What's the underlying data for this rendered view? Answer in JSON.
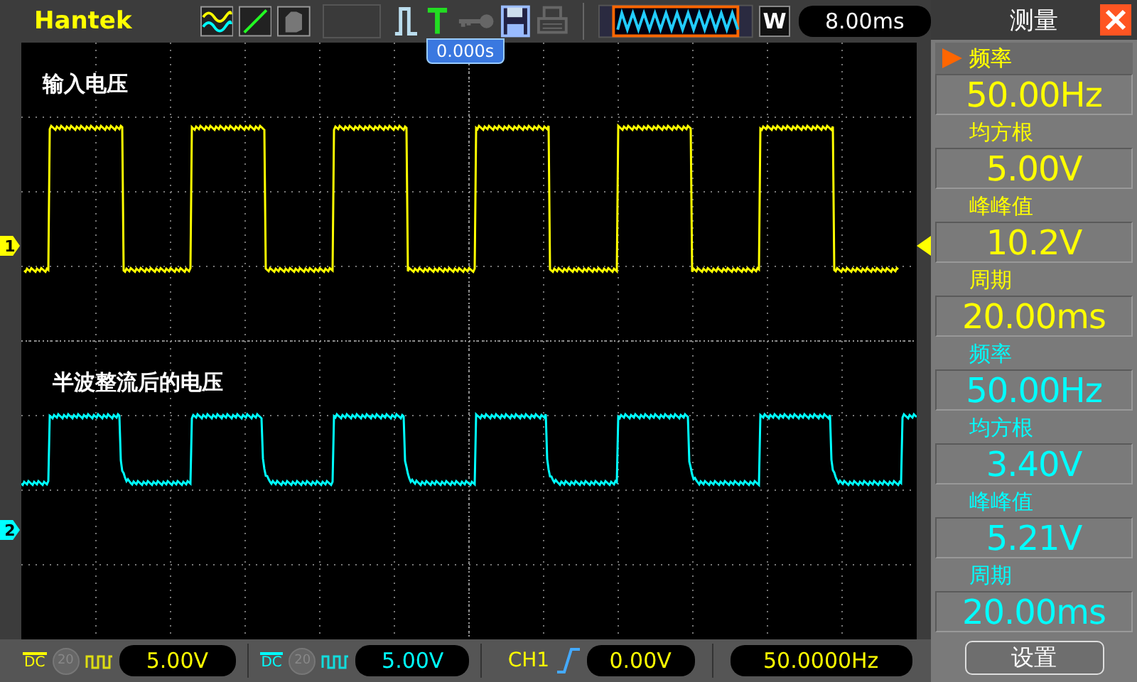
{
  "toolbar": {
    "brand": "Hantek",
    "timebase_mode": "W",
    "timebase": "8.00ms"
  },
  "screen": {
    "trigger_time": "0.000s",
    "channels": [
      {
        "number": "1",
        "label": "输入电压",
        "color": "#ffff00",
        "kind": "square"
      },
      {
        "number": "2",
        "label": "半波整流后的电压",
        "color": "#00ffff",
        "kind": "rectified"
      }
    ]
  },
  "measure_panel": {
    "title": "测量",
    "groups": [
      {
        "color": "#ffff00",
        "items": [
          {
            "name": "频率",
            "value": "50.00Hz",
            "selected": true
          },
          {
            "name": "均方根",
            "value": "5.00V",
            "selected": false
          },
          {
            "name": "峰峰值",
            "value": "10.2V",
            "selected": false
          },
          {
            "name": "周期",
            "value": "20.00ms",
            "selected": false
          }
        ]
      },
      {
        "color": "#00ffff",
        "items": [
          {
            "name": "频率",
            "value": "50.00Hz",
            "selected": false
          },
          {
            "name": "均方根",
            "value": "3.40V",
            "selected": false
          },
          {
            "name": "峰峰值",
            "value": "5.21V",
            "selected": false
          },
          {
            "name": "周期",
            "value": "20.00ms",
            "selected": false
          }
        ]
      }
    ],
    "settings_button": "设置"
  },
  "bottom_bar": {
    "channels": [
      {
        "coupling": "DC",
        "probe": "20",
        "scale": "5.00V",
        "color": "#ffff00"
      },
      {
        "coupling": "DC",
        "probe": "20",
        "scale": "5.00V",
        "color": "#00ffff"
      }
    ],
    "trigger": {
      "source": "CH1",
      "level": "0.00V"
    },
    "frequency": "50.0000Hz"
  }
}
